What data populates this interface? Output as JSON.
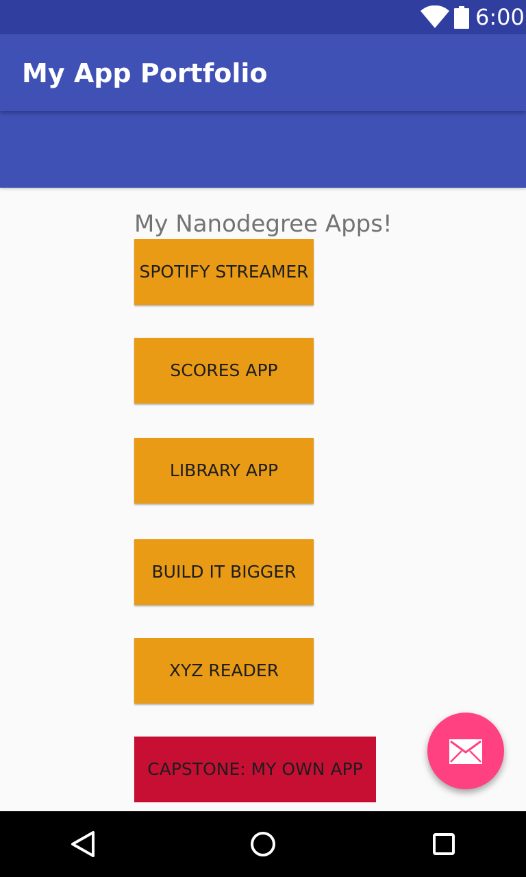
{
  "status_bar": {
    "time": "6:00",
    "wifi_icon": "wifi-full-icon",
    "battery_icon": "battery-full-icon"
  },
  "app_bar": {
    "title": "My App Portfolio"
  },
  "content": {
    "heading": "My Nanodegree Apps!",
    "buttons": [
      {
        "label": "SPOTIFY STREAMER",
        "color": "#e99b15"
      },
      {
        "label": "SCORES APP",
        "color": "#e99b15"
      },
      {
        "label": "LIBRARY APP",
        "color": "#e99b15"
      },
      {
        "label": "BUILD IT BIGGER",
        "color": "#e99b15"
      },
      {
        "label": "XYZ READER",
        "color": "#e99b15"
      },
      {
        "label": "CAPSTONE: MY OWN APP",
        "color": "#c70f34"
      }
    ]
  },
  "fab": {
    "icon": "email-icon",
    "color": "#ff4081"
  },
  "navigation_bar": {
    "back_icon": "back-triangle-icon",
    "home_icon": "home-circle-icon",
    "recents_icon": "recents-square-icon"
  },
  "colors": {
    "primary": "#3f51b5",
    "primary_dark": "#303f9f",
    "accent": "#ff4081",
    "background": "#fafafa"
  }
}
